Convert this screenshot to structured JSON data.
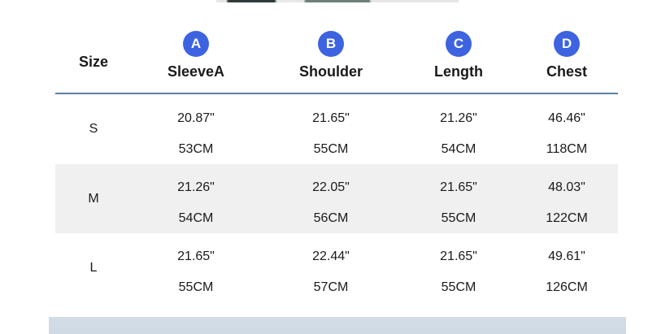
{
  "table": {
    "size_header": "Size",
    "columns": [
      {
        "badge": "A",
        "label": "SleeveA"
      },
      {
        "badge": "B",
        "label": "Shoulder"
      },
      {
        "badge": "C",
        "label": "Length"
      },
      {
        "badge": "D",
        "label": "Chest"
      }
    ],
    "rows": [
      {
        "size": "S",
        "inches": [
          "20.87\"",
          "21.65\"",
          "21.26\"",
          "46.46\""
        ],
        "cm": [
          "53CM",
          "55CM",
          "54CM",
          "118CM"
        ]
      },
      {
        "size": "M",
        "inches": [
          "21.26\"",
          "22.05\"",
          "21.65\"",
          "48.03\""
        ],
        "cm": [
          "54CM",
          "56CM",
          "55CM",
          "122CM"
        ]
      },
      {
        "size": "L",
        "inches": [
          "21.65\"",
          "22.44\"",
          "21.65\"",
          "49.61\""
        ],
        "cm": [
          "55CM",
          "57CM",
          "55CM",
          "126CM"
        ]
      }
    ]
  },
  "colors": {
    "badge": "#3d63e0",
    "header_rule": "#5b7fa6",
    "shaded_row": "#f0f0f0"
  }
}
